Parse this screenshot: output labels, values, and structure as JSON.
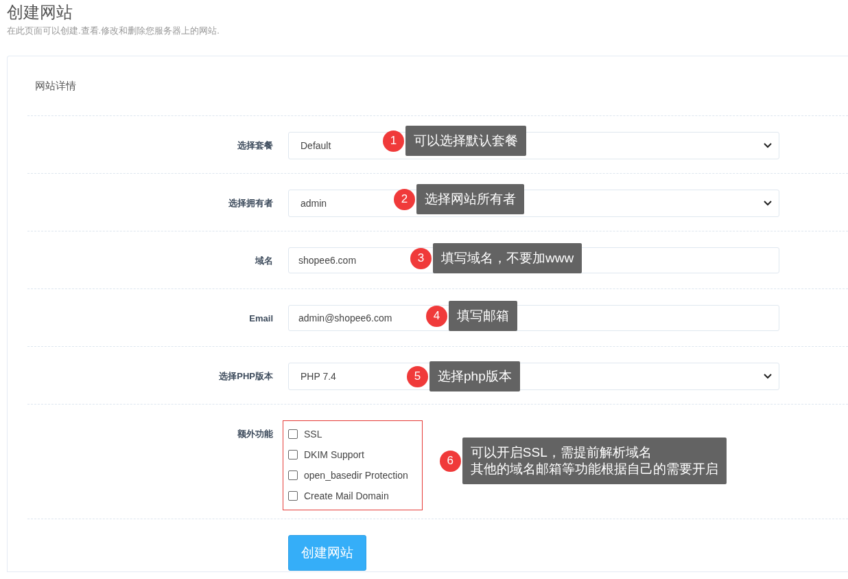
{
  "page": {
    "title": "创建网站",
    "subtitle": "在此页面可以创建.查看.修改和删除您服务器上的网站."
  },
  "card": {
    "heading": "网站详情"
  },
  "fields": [
    {
      "kind": "select",
      "label": "选择套餐",
      "value": "Default",
      "note": {
        "number": "1",
        "lines": [
          "可以选择默认套餐"
        ]
      }
    },
    {
      "kind": "select",
      "label": "选择拥有者",
      "value": "admin",
      "note": {
        "number": "2",
        "lines": [
          "选择网站所有者"
        ]
      }
    },
    {
      "kind": "text",
      "label": "域名",
      "value": "shopee6.com",
      "note": {
        "number": "3",
        "lines": [
          "填写域名，不要加www"
        ]
      }
    },
    {
      "kind": "text",
      "label": "Email",
      "value": "admin@shopee6.com",
      "note": {
        "number": "4",
        "lines": [
          "填写邮箱"
        ]
      }
    },
    {
      "kind": "select",
      "label": "选择PHP版本",
      "value": "PHP 7.4",
      "note": {
        "number": "5",
        "lines": [
          "选择php版本"
        ]
      }
    },
    {
      "kind": "checkboxes",
      "label": "额外功能",
      "options": [
        {
          "label": "SSL",
          "checked": false
        },
        {
          "label": "DKIM Support",
          "checked": false
        },
        {
          "label": "open_basedir Protection",
          "checked": false
        },
        {
          "label": "Create Mail Domain",
          "checked": false
        }
      ],
      "note": {
        "number": "6",
        "lines": [
          "可以开启SSL，需提前解析域名",
          "其他的域名邮箱等功能根据自己的需要开启"
        ]
      }
    }
  ],
  "submit": {
    "label": "创建网站"
  }
}
